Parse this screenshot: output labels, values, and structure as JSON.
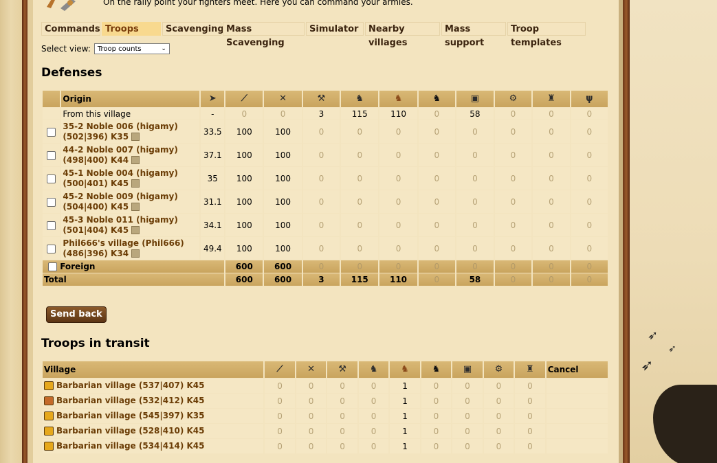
{
  "intro_text": "On the rally point your fighters meet. Here you can command your armies.",
  "tabs": [
    "Commands",
    "Troops",
    "Scavenging",
    "Mass Scavenging",
    "Simulator",
    "Nearby villages",
    "Mass support",
    "Troop templates"
  ],
  "active_tab": "Troops",
  "select_view": {
    "label": "Select view:",
    "value": "Troop counts"
  },
  "defenses": {
    "title": "Defenses",
    "origin_header": "Origin",
    "from_row": {
      "label": "From this village",
      "distance": "-",
      "values": [
        "0",
        "0",
        "3",
        "115",
        "110",
        "0",
        "58",
        "0",
        "0",
        "0"
      ]
    },
    "rows": [
      {
        "line1": "35-2 Noble 006 (higamy)",
        "line2": "(502|396) K35",
        "distance": "33.5",
        "values": [
          "100",
          "100",
          "0",
          "0",
          "0",
          "0",
          "0",
          "0",
          "0",
          "0"
        ]
      },
      {
        "line1": "44-2 Noble 007 (higamy)",
        "line2": "(498|400) K44",
        "distance": "37.1",
        "values": [
          "100",
          "100",
          "0",
          "0",
          "0",
          "0",
          "0",
          "0",
          "0",
          "0"
        ]
      },
      {
        "line1": "45-1 Noble 004 (higamy)",
        "line2": "(500|401) K45",
        "distance": "35",
        "values": [
          "100",
          "100",
          "0",
          "0",
          "0",
          "0",
          "0",
          "0",
          "0",
          "0"
        ]
      },
      {
        "line1": "45-2 Noble 009 (higamy)",
        "line2": "(504|400) K45",
        "distance": "31.1",
        "values": [
          "100",
          "100",
          "0",
          "0",
          "0",
          "0",
          "0",
          "0",
          "0",
          "0"
        ]
      },
      {
        "line1": "45-3 Noble 011 (higamy)",
        "line2": "(501|404) K45",
        "distance": "34.1",
        "values": [
          "100",
          "100",
          "0",
          "0",
          "0",
          "0",
          "0",
          "0",
          "0",
          "0"
        ]
      },
      {
        "line1": "Phil666's village (Phil666)",
        "line2": "(486|396) K34",
        "distance": "49.4",
        "values": [
          "100",
          "100",
          "0",
          "0",
          "0",
          "0",
          "0",
          "0",
          "0",
          "0"
        ]
      }
    ],
    "foreign": {
      "label": "Foreign",
      "values": [
        "600",
        "600",
        "0",
        "0",
        "0",
        "0",
        "0",
        "0",
        "0",
        "0"
      ]
    },
    "total": {
      "label": "Total",
      "values": [
        "600",
        "600",
        "3",
        "115",
        "110",
        "0",
        "58",
        "0",
        "0",
        "0"
      ]
    },
    "send_back_label": "Send back"
  },
  "transit": {
    "title": "Troops in transit",
    "village_header": "Village",
    "cancel_header": "Cancel",
    "rows": [
      {
        "name": "Barbarian village (537|407) K45",
        "values": [
          "0",
          "0",
          "0",
          "0",
          "1",
          "0",
          "0",
          "0",
          "0"
        ]
      },
      {
        "name": "Barbarian village (532|412) K45",
        "values": [
          "0",
          "0",
          "0",
          "0",
          "1",
          "0",
          "0",
          "0",
          "0"
        ]
      },
      {
        "name": "Barbarian village (545|397) K35",
        "values": [
          "0",
          "0",
          "0",
          "0",
          "1",
          "0",
          "0",
          "0",
          "0"
        ]
      },
      {
        "name": "Barbarian village (528|410) K45",
        "values": [
          "0",
          "0",
          "0",
          "0",
          "1",
          "0",
          "0",
          "0",
          "0"
        ]
      },
      {
        "name": "Barbarian village (534|414) K45",
        "values": [
          "0",
          "0",
          "0",
          "0",
          "1",
          "0",
          "0",
          "0",
          "0"
        ]
      }
    ]
  },
  "unit_icons": [
    "spear-icon",
    "sword-icon",
    "axe-icon",
    "scout-icon",
    "light-cavalry-icon",
    "heavy-cavalry-icon",
    "ram-icon",
    "catapult-icon",
    "paladin-icon",
    "militia-icon"
  ]
}
